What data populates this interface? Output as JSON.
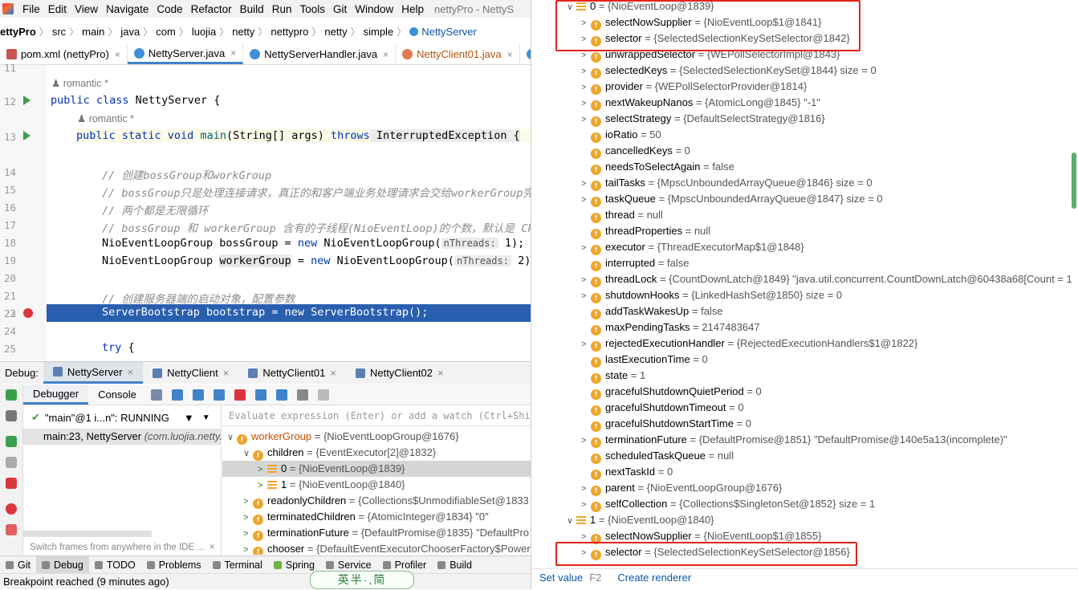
{
  "menubar": {
    "items": [
      "File",
      "Edit",
      "View",
      "Navigate",
      "Code",
      "Refactor",
      "Build",
      "Run",
      "Tools",
      "Git",
      "Window",
      "Help"
    ],
    "window_title": "nettyPro - NettyS"
  },
  "breadcrumb": [
    "ettyPro",
    "src",
    "main",
    "java",
    "com",
    "luojia",
    "netty",
    "nettypro",
    "netty",
    "simple",
    "NettyServer"
  ],
  "editor_tabs": [
    {
      "label": "pom.xml (nettyPro)",
      "icon": "maven-icon",
      "color": "#c75450"
    },
    {
      "label": "NettyServer.java",
      "icon": "class-icon",
      "color": "#3d8fd6"
    },
    {
      "label": "NettyServerHandler.java",
      "icon": "class-icon",
      "color": "#3d8fd6"
    },
    {
      "label": "NettyClient01.java",
      "icon": "class-icon",
      "color": "#e07b53"
    }
  ],
  "code": {
    "author": "romantic *",
    "line_numbers": [
      "11",
      "12",
      "13",
      "14",
      "15",
      "16",
      "17",
      "18",
      "19",
      "20",
      "21",
      "22",
      "23",
      "24",
      "25"
    ],
    "l12_a": "public class ",
    "l12_b": "NettyServer {",
    "l13_a": "public static void ",
    "l13_fn": "main",
    "l13_b": "(String[] args) ",
    "l13_kw": "throws",
    "l13_c": " InterruptedException {",
    "c1": "// 创建bossGroup和workGroup",
    "c2": "// bossGroup只是处理连接请求，真正的和客户端业务处理请求会交给workerGroup完成",
    "c3": "// 两个都是无限循环",
    "c4": "// bossGroup 和 workerGroup 含有的子线程(NioEventLoop)的个数，默认是 CPU",
    "l19_a": "NioEventLoopGroup bossGroup = ",
    "l19_kw": "new",
    "l19_b": " NioEventLoopGroup(",
    "l19_hint": "nThreads:",
    "l19_c": " 1);",
    "l20_a": "NioEventLoopGroup ",
    "l20_hl": "workerGroup",
    "l20_b": " = ",
    "l20_kw": "new",
    "l20_c": " NioEventLoopGroup(",
    "l20_hint": "nThreads:",
    "l20_d": " 2);",
    "c5": "// 创建服务器端的启动对象，配置参数",
    "l23": "ServerBootstrap bootstrap = new ServerBootstrap();",
    "l25_kw": "try",
    "l25_b": " {"
  },
  "debug": {
    "label": "Debug:",
    "tabs": [
      "NettyServer",
      "NettyClient",
      "NettyClient01",
      "NettyClient02"
    ],
    "sub_tabs": [
      "Debugger",
      "Console"
    ],
    "thread": "\"main\"@1 i...n\": RUNNING",
    "frame_a": "main:23, NettyServer ",
    "frame_b": "(com.luojia.netty.",
    "switch_hint": "Switch frames from anywhere in the IDE ...",
    "eval_placeholder": "Evaluate expression (Enter) or add a watch (Ctrl+Shift"
  },
  "vars": [
    {
      "arrow": "∨",
      "icon": "f",
      "name": "workerGroup",
      "val": " = {NioEventLoopGroup@1676}"
    },
    {
      "arrow": "∨",
      "icon": "f",
      "name": "children",
      "val": " = {EventExecutor[2]@1832}"
    },
    {
      "arrow": ">",
      "icon": "list",
      "name": "0",
      "val": " = {NioEventLoop@1839}"
    },
    {
      "arrow": ">",
      "icon": "list",
      "name": "1",
      "val": " = {NioEventLoop@1840}"
    },
    {
      "arrow": ">",
      "icon": "f",
      "name": "readonlyChildren",
      "val": " = {Collections$UnmodifiableSet@1833"
    },
    {
      "arrow": ">",
      "icon": "f",
      "name": "terminatedChildren",
      "val": " = {AtomicInteger@1834} \"0\""
    },
    {
      "arrow": ">",
      "icon": "f",
      "name": "terminationFuture",
      "val": " = {DefaultPromise@1835} \"DefaultPro"
    },
    {
      "arrow": ">",
      "icon": "f",
      "name": "chooser",
      "val": " = {DefaultEventExecutorChooserFactory$Power"
    }
  ],
  "bottom_tools": [
    "Git",
    "Debug",
    "TODO",
    "Problems",
    "Terminal",
    "Spring",
    "Service",
    "Profiler",
    "Build"
  ],
  "status": "Breakpoint reached (9 minutes ago)",
  "watermark": "英半·,简",
  "right_vars": [
    {
      "arrow": "∨",
      "icon": "list",
      "name": "0",
      "val": " = {NioEventLoop@1839}",
      "ind": 0
    },
    {
      "arrow": ">",
      "icon": "f",
      "name": "selectNowSupplier",
      "val": " = {NioEventLoop$1@1841}",
      "ind": 1
    },
    {
      "arrow": ">",
      "icon": "f",
      "name": "selector",
      "val": " = {SelectedSelectionKeySetSelector@1842}",
      "ind": 1
    },
    {
      "arrow": ">",
      "icon": "f",
      "name": "unwrappedSelector",
      "val": " = {WEPollSelectorImpl@1843}",
      "ind": 1
    },
    {
      "arrow": ">",
      "icon": "f",
      "name": "selectedKeys",
      "val": " = {SelectedSelectionKeySet@1844}  size = 0",
      "ind": 1
    },
    {
      "arrow": ">",
      "icon": "f",
      "name": "provider",
      "val": " = {WEPollSelectorProvider@1814}",
      "ind": 1
    },
    {
      "arrow": ">",
      "icon": "f",
      "name": "nextWakeupNanos",
      "val": " = {AtomicLong@1845} \"-1\"",
      "ind": 1
    },
    {
      "arrow": ">",
      "icon": "f",
      "name": "selectStrategy",
      "val": " = {DefaultSelectStrategy@1816}",
      "ind": 1
    },
    {
      "arrow": "",
      "icon": "f",
      "name": "ioRatio",
      "val": " = 50",
      "ind": 1
    },
    {
      "arrow": "",
      "icon": "f",
      "name": "cancelledKeys",
      "val": " = 0",
      "ind": 1
    },
    {
      "arrow": "",
      "icon": "f",
      "name": "needsToSelectAgain",
      "val": " = false",
      "ind": 1
    },
    {
      "arrow": ">",
      "icon": "f",
      "name": "tailTasks",
      "val": " = {MpscUnboundedArrayQueue@1846}  size = 0",
      "ind": 1
    },
    {
      "arrow": ">",
      "icon": "f",
      "name": "taskQueue",
      "val": " = {MpscUnboundedArrayQueue@1847}  size = 0",
      "ind": 1
    },
    {
      "arrow": "",
      "icon": "f",
      "name": "thread",
      "val": " = null",
      "ind": 1
    },
    {
      "arrow": "",
      "icon": "f",
      "name": "threadProperties",
      "val": " = null",
      "ind": 1
    },
    {
      "arrow": ">",
      "icon": "f",
      "name": "executor",
      "val": " = {ThreadExecutorMap$1@1848}",
      "ind": 1
    },
    {
      "arrow": "",
      "icon": "f",
      "name": "interrupted",
      "val": " = false",
      "ind": 1
    },
    {
      "arrow": ">",
      "icon": "f",
      "name": "threadLock",
      "val": " = {CountDownLatch@1849} \"java.util.concurrent.CountDownLatch@60438a68[Count = 1",
      "ind": 1
    },
    {
      "arrow": ">",
      "icon": "f",
      "name": "shutdownHooks",
      "val": " = {LinkedHashSet@1850}  size = 0",
      "ind": 1
    },
    {
      "arrow": "",
      "icon": "f",
      "name": "addTaskWakesUp",
      "val": " = false",
      "ind": 1
    },
    {
      "arrow": "",
      "icon": "f",
      "name": "maxPendingTasks",
      "val": " = 2147483647",
      "ind": 1
    },
    {
      "arrow": ">",
      "icon": "f",
      "name": "rejectedExecutionHandler",
      "val": " = {RejectedExecutionHandlers$1@1822}",
      "ind": 1
    },
    {
      "arrow": "",
      "icon": "f",
      "name": "lastExecutionTime",
      "val": " = 0",
      "ind": 1
    },
    {
      "arrow": "",
      "icon": "f",
      "name": "state",
      "val": " = 1",
      "ind": 1
    },
    {
      "arrow": "",
      "icon": "f",
      "name": "gracefulShutdownQuietPeriod",
      "val": " = 0",
      "ind": 1
    },
    {
      "arrow": "",
      "icon": "f",
      "name": "gracefulShutdownTimeout",
      "val": " = 0",
      "ind": 1
    },
    {
      "arrow": "",
      "icon": "f",
      "name": "gracefulShutdownStartTime",
      "val": " = 0",
      "ind": 1
    },
    {
      "arrow": ">",
      "icon": "f",
      "name": "terminationFuture",
      "val": " = {DefaultPromise@1851} \"DefaultPromise@140e5a13(incomplete)\"",
      "ind": 1
    },
    {
      "arrow": "",
      "icon": "f",
      "name": "scheduledTaskQueue",
      "val": " = null",
      "ind": 1
    },
    {
      "arrow": "",
      "icon": "f",
      "name": "nextTaskId",
      "val": " = 0",
      "ind": 1
    },
    {
      "arrow": ">",
      "icon": "f",
      "name": "parent",
      "val": " = {NioEventLoopGroup@1676}",
      "ind": 1
    },
    {
      "arrow": ">",
      "icon": "f",
      "name": "selfCollection",
      "val": " = {Collections$SingletonSet@1852}  size = 1",
      "ind": 1
    },
    {
      "arrow": "∨",
      "icon": "list",
      "name": "1",
      "val": " = {NioEventLoop@1840}",
      "ind": 0
    },
    {
      "arrow": ">",
      "icon": "f",
      "name": "selectNowSupplier",
      "val": " = {NioEventLoop$1@1855}",
      "ind": 1
    },
    {
      "arrow": ">",
      "icon": "f",
      "name": "selector",
      "val": " = {SelectedSelectionKeySetSelector@1856}",
      "ind": 1
    }
  ],
  "right_footer": {
    "set_value": "Set value",
    "set_key": "F2",
    "create": "Create renderer"
  }
}
